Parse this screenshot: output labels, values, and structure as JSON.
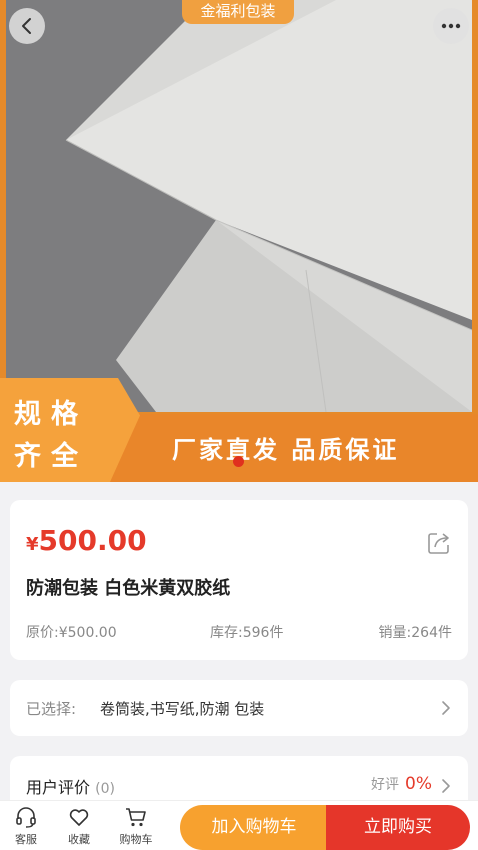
{
  "hero": {
    "brand_tag": "金福利包装",
    "badge_line1": "规格",
    "badge_line2": "齐全",
    "slogan": "厂家直发 品质保证"
  },
  "product": {
    "currency": "¥",
    "price": "500.00",
    "title": "防潮包装 白色米黄双胶纸",
    "original_price": "原价:¥500.00",
    "stock": "库存:596件",
    "sales": "销量:264件"
  },
  "selection": {
    "label": "已选择:",
    "value": "卷筒装,书写纸,防潮 包装"
  },
  "reviews": {
    "title": "用户评价",
    "count": "(0)",
    "good_label": "好评",
    "good_rate": "0%"
  },
  "bottom_bar": {
    "service": "客服",
    "favorite": "收藏",
    "cart": "购物车",
    "add_to_cart": "加入购物车",
    "buy_now": "立即购买"
  },
  "colors": {
    "accent": "#e53a2a",
    "orange": "#f7a12f",
    "banner": "#e9862a"
  }
}
